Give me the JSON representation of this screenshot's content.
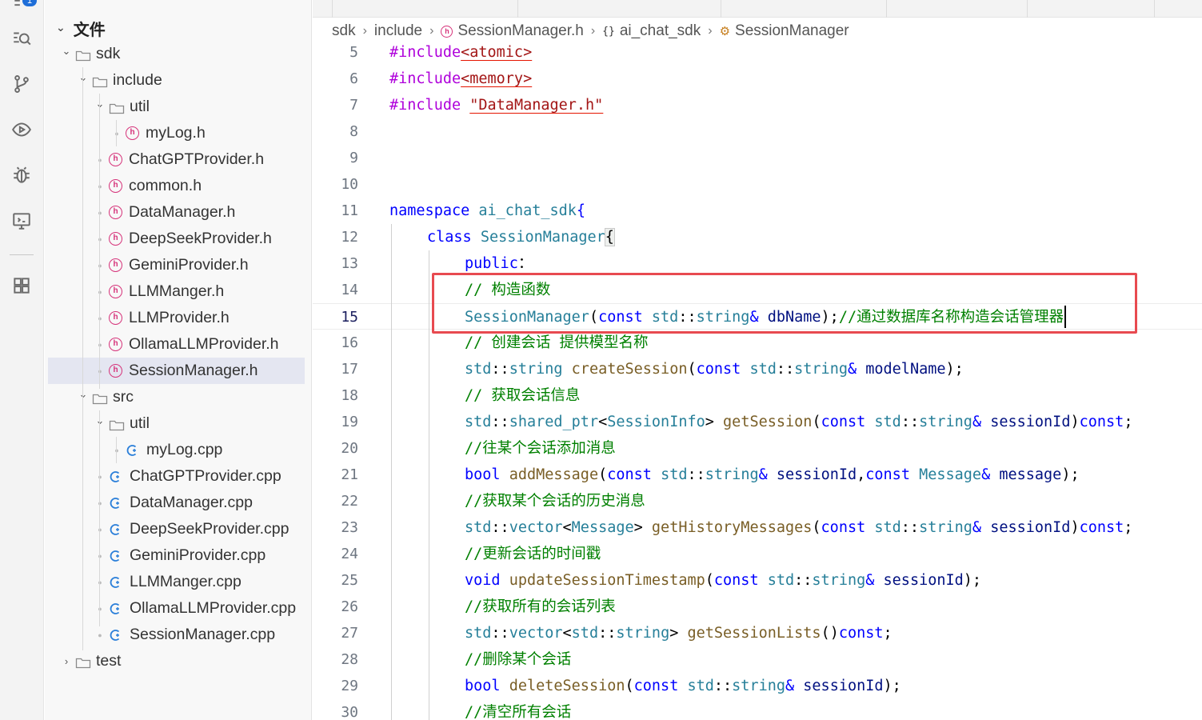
{
  "activity_bar": {
    "badge": "1",
    "icons": [
      "explorer-icon",
      "search-icon",
      "source-control-icon",
      "run-icon",
      "debug-icon",
      "remote-icon",
      "extensions-icon"
    ]
  },
  "sidebar": {
    "title": "文件",
    "tree": [
      {
        "label": "sdk",
        "kind": "folder",
        "depth": 0,
        "expanded": true
      },
      {
        "label": "include",
        "kind": "folder",
        "depth": 1,
        "expanded": true
      },
      {
        "label": "util",
        "kind": "folder",
        "depth": 2,
        "expanded": true
      },
      {
        "label": "myLog.h",
        "kind": "h",
        "depth": 3
      },
      {
        "label": "ChatGPTProvider.h",
        "kind": "h",
        "depth": 2
      },
      {
        "label": "common.h",
        "kind": "h",
        "depth": 2
      },
      {
        "label": "DataManager.h",
        "kind": "h",
        "depth": 2
      },
      {
        "label": "DeepSeekProvider.h",
        "kind": "h",
        "depth": 2
      },
      {
        "label": "GeminiProvider.h",
        "kind": "h",
        "depth": 2
      },
      {
        "label": "LLMManger.h",
        "kind": "h",
        "depth": 2
      },
      {
        "label": "LLMProvider.h",
        "kind": "h",
        "depth": 2
      },
      {
        "label": "OllamaLLMProvider.h",
        "kind": "h",
        "depth": 2
      },
      {
        "label": "SessionManager.h",
        "kind": "h",
        "depth": 2,
        "selected": true
      },
      {
        "label": "src",
        "kind": "folder",
        "depth": 1,
        "expanded": true
      },
      {
        "label": "util",
        "kind": "folder",
        "depth": 2,
        "expanded": true
      },
      {
        "label": "myLog.cpp",
        "kind": "cpp",
        "depth": 3
      },
      {
        "label": "ChatGPTProvider.cpp",
        "kind": "cpp",
        "depth": 2
      },
      {
        "label": "DataManager.cpp",
        "kind": "cpp",
        "depth": 2
      },
      {
        "label": "DeepSeekProvider.cpp",
        "kind": "cpp",
        "depth": 2
      },
      {
        "label": "GeminiProvider.cpp",
        "kind": "cpp",
        "depth": 2
      },
      {
        "label": "LLMManger.cpp",
        "kind": "cpp",
        "depth": 2
      },
      {
        "label": "OllamaLLMProvider.cpp",
        "kind": "cpp",
        "depth": 2
      },
      {
        "label": "SessionManager.cpp",
        "kind": "cpp",
        "depth": 2
      },
      {
        "label": "test",
        "kind": "folder",
        "depth": 0,
        "expanded": false
      }
    ]
  },
  "breadcrumb": {
    "items": [
      "sdk",
      "include",
      "SessionManager.h",
      "ai_chat_sdk",
      "SessionManager"
    ]
  },
  "editor": {
    "active_line": "15",
    "lines": [
      {
        "n": "5",
        "indent": 0,
        "tokens": [
          [
            "pp",
            "#include"
          ],
          [
            "st ul",
            "<atomic>"
          ]
        ]
      },
      {
        "n": "6",
        "indent": 0,
        "tokens": [
          [
            "pp",
            "#include"
          ],
          [
            "st ul",
            "<memory>"
          ]
        ]
      },
      {
        "n": "7",
        "indent": 0,
        "tokens": [
          [
            "pp",
            "#include "
          ],
          [
            "st ul",
            "\"DataManager.h\""
          ]
        ]
      },
      {
        "n": "8",
        "indent": 0,
        "tokens": []
      },
      {
        "n": "9",
        "indent": 0,
        "tokens": []
      },
      {
        "n": "10",
        "indent": 0,
        "tokens": []
      },
      {
        "n": "11",
        "indent": 0,
        "tokens": [
          [
            "kw",
            "namespace "
          ],
          [
            "ty",
            "ai_chat_sdk"
          ],
          [
            "kw",
            "{"
          ]
        ]
      },
      {
        "n": "12",
        "indent": 1,
        "tokens": [
          [
            "kw",
            "class "
          ],
          [
            "ty",
            "SessionManager"
          ],
          [
            "brace-hl",
            "{"
          ]
        ]
      },
      {
        "n": "13",
        "indent": 2,
        "tokens": [
          [
            "kw",
            "public"
          ],
          [
            "",
            "："
          ]
        ]
      },
      {
        "n": "14",
        "indent": 2,
        "tokens": [
          [
            "cm",
            "// 构造函数"
          ]
        ]
      },
      {
        "n": "15",
        "indent": 2,
        "tokens": [
          [
            "ty",
            "SessionManager"
          ],
          [
            "",
            "("
          ],
          [
            "kw",
            "const "
          ],
          [
            "ty",
            "std"
          ],
          [
            "",
            "::"
          ],
          [
            "ty",
            "string"
          ],
          [
            "kw",
            "& "
          ],
          [
            "id",
            "dbName"
          ],
          [
            "",
            ");"
          ],
          [
            "cm",
            "//通过数据库名称构造会话管理器"
          ]
        ]
      },
      {
        "n": "16",
        "indent": 2,
        "tokens": [
          [
            "cm",
            "// 创建会话 提供模型名称"
          ]
        ]
      },
      {
        "n": "17",
        "indent": 2,
        "tokens": [
          [
            "ty",
            "std"
          ],
          [
            "",
            "::"
          ],
          [
            "ty",
            "string "
          ],
          [
            "fn",
            "createSession"
          ],
          [
            "",
            "("
          ],
          [
            "kw",
            "const "
          ],
          [
            "ty",
            "std"
          ],
          [
            "",
            "::"
          ],
          [
            "ty",
            "string"
          ],
          [
            "kw",
            "& "
          ],
          [
            "id",
            "modelName"
          ],
          [
            "",
            ");"
          ]
        ]
      },
      {
        "n": "18",
        "indent": 2,
        "tokens": [
          [
            "cm",
            "// 获取会话信息"
          ]
        ]
      },
      {
        "n": "19",
        "indent": 2,
        "tokens": [
          [
            "ty",
            "std"
          ],
          [
            "",
            "::"
          ],
          [
            "ty",
            "shared_ptr"
          ],
          [
            "",
            "<"
          ],
          [
            "ty",
            "SessionInfo"
          ],
          [
            "",
            "> "
          ],
          [
            "fn",
            "getSession"
          ],
          [
            "",
            "("
          ],
          [
            "kw",
            "const "
          ],
          [
            "ty",
            "std"
          ],
          [
            "",
            "::"
          ],
          [
            "ty",
            "string"
          ],
          [
            "kw",
            "& "
          ],
          [
            "id",
            "sessionId"
          ],
          [
            "",
            ")"
          ],
          [
            "kw",
            "const"
          ],
          [
            "",
            ";"
          ]
        ]
      },
      {
        "n": "20",
        "indent": 2,
        "tokens": [
          [
            "cm",
            "//往某个会话添加消息"
          ]
        ]
      },
      {
        "n": "21",
        "indent": 2,
        "tokens": [
          [
            "kw",
            "bool "
          ],
          [
            "fn",
            "addMessage"
          ],
          [
            "",
            "("
          ],
          [
            "kw",
            "const "
          ],
          [
            "ty",
            "std"
          ],
          [
            "",
            "::"
          ],
          [
            "ty",
            "string"
          ],
          [
            "kw",
            "& "
          ],
          [
            "id",
            "sessionId"
          ],
          [
            "",
            ","
          ],
          [
            "kw",
            "const "
          ],
          [
            "ty",
            "Message"
          ],
          [
            "kw",
            "& "
          ],
          [
            "id",
            "message"
          ],
          [
            "",
            ");"
          ]
        ]
      },
      {
        "n": "22",
        "indent": 2,
        "tokens": [
          [
            "cm",
            "//获取某个会话的历史消息"
          ]
        ]
      },
      {
        "n": "23",
        "indent": 2,
        "tokens": [
          [
            "ty",
            "std"
          ],
          [
            "",
            "::"
          ],
          [
            "ty",
            "vector"
          ],
          [
            "",
            "<"
          ],
          [
            "ty",
            "Message"
          ],
          [
            "",
            "> "
          ],
          [
            "fn",
            "getHistoryMessages"
          ],
          [
            "",
            "("
          ],
          [
            "kw",
            "const "
          ],
          [
            "ty",
            "std"
          ],
          [
            "",
            "::"
          ],
          [
            "ty",
            "string"
          ],
          [
            "kw",
            "& "
          ],
          [
            "id",
            "sessionId"
          ],
          [
            "",
            ")"
          ],
          [
            "kw",
            "const"
          ],
          [
            "",
            ";"
          ]
        ]
      },
      {
        "n": "24",
        "indent": 2,
        "tokens": [
          [
            "cm",
            "//更新会话的时间戳"
          ]
        ]
      },
      {
        "n": "25",
        "indent": 2,
        "tokens": [
          [
            "kw",
            "void "
          ],
          [
            "fn",
            "updateSessionTimestamp"
          ],
          [
            "",
            "("
          ],
          [
            "kw",
            "const "
          ],
          [
            "ty",
            "std"
          ],
          [
            "",
            "::"
          ],
          [
            "ty",
            "string"
          ],
          [
            "kw",
            "& "
          ],
          [
            "id",
            "sessionId"
          ],
          [
            "",
            ");"
          ]
        ]
      },
      {
        "n": "26",
        "indent": 2,
        "tokens": [
          [
            "cm",
            "//获取所有的会话列表"
          ]
        ]
      },
      {
        "n": "27",
        "indent": 2,
        "tokens": [
          [
            "ty",
            "std"
          ],
          [
            "",
            "::"
          ],
          [
            "ty",
            "vector"
          ],
          [
            "",
            "<"
          ],
          [
            "ty",
            "std"
          ],
          [
            "",
            "::"
          ],
          [
            "ty",
            "string"
          ],
          [
            "",
            "> "
          ],
          [
            "fn",
            "getSessionLists"
          ],
          [
            "",
            "()"
          ],
          [
            "kw",
            "const"
          ],
          [
            "",
            ";"
          ]
        ]
      },
      {
        "n": "28",
        "indent": 2,
        "tokens": [
          [
            "cm",
            "//删除某个会话"
          ]
        ]
      },
      {
        "n": "29",
        "indent": 2,
        "tokens": [
          [
            "kw",
            "bool "
          ],
          [
            "fn",
            "deleteSession"
          ],
          [
            "",
            "("
          ],
          [
            "kw",
            "const "
          ],
          [
            "ty",
            "std"
          ],
          [
            "",
            "::"
          ],
          [
            "ty",
            "string"
          ],
          [
            "kw",
            "& "
          ],
          [
            "id",
            "sessionId"
          ],
          [
            "",
            ");"
          ]
        ]
      },
      {
        "n": "30",
        "indent": 2,
        "tokens": [
          [
            "cm",
            "//清空所有会话"
          ]
        ]
      }
    ]
  },
  "colors": {
    "keyword": "#0000ff",
    "preprocessor": "#af00db",
    "type": "#267f99",
    "function": "#795e26",
    "identifier": "#001080",
    "comment": "#008000",
    "string": "#a31515",
    "highlight_box": "#e84a50",
    "header_icon": "#d6337a",
    "cpp_icon": "#2b7fd9"
  }
}
